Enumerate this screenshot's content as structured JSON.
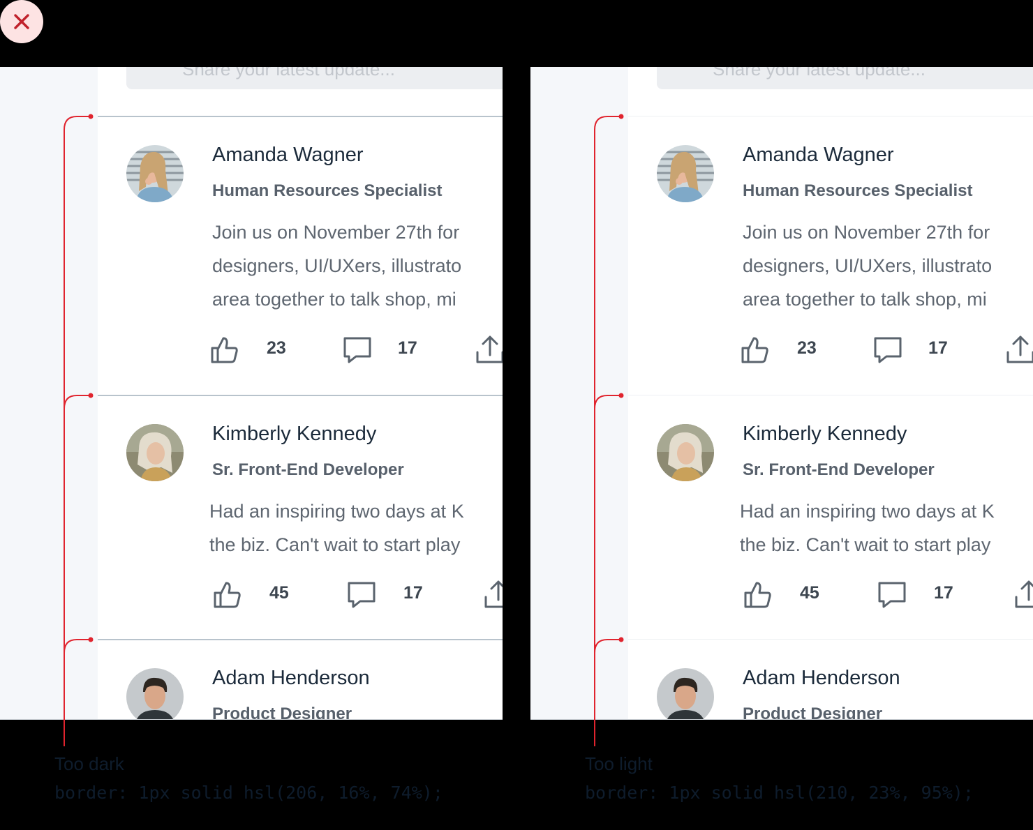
{
  "status": {
    "icon": "close-icon",
    "color": "#c0212b"
  },
  "composer_placeholder": "Share your latest update...",
  "annotation_color": "#e0242e",
  "examples": [
    {
      "label": "Too dark",
      "code": "border: 1px solid hsl(206, 16%, 74%);",
      "border_color": "#b8c3cc"
    },
    {
      "label": "Too light",
      "code": "border: 1px solid hsl(210, 23%, 95%);",
      "border_color": "#eef0f3"
    }
  ],
  "posts": [
    {
      "name": "Amanda Wagner",
      "role": "Human Resources Specialist",
      "lines": [
        "Join us on November 27th for",
        "designers, UI/UXers, illustrato",
        "area together to talk shop, mi"
      ],
      "likes": "23",
      "comments": "17"
    },
    {
      "name": "Kimberly Kennedy",
      "role": "Sr. Front-End Developer",
      "lines": [
        "Had an inspiring two days at K",
        "the biz. Can't wait to start play"
      ],
      "likes": "45",
      "comments": "17"
    },
    {
      "name": "Adam Henderson",
      "role": "Product Designer",
      "lines": [],
      "likes": "",
      "comments": ""
    }
  ]
}
